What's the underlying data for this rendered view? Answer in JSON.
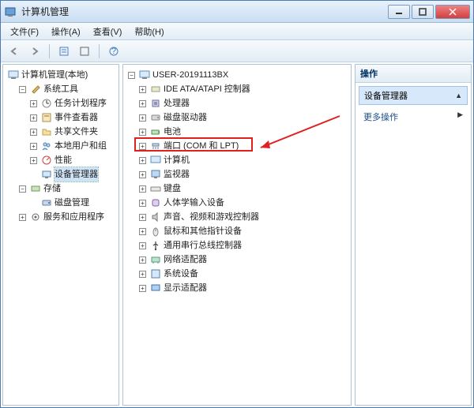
{
  "window_title": "计算机管理",
  "menu": {
    "file": "文件(F)",
    "action": "操作(A)",
    "view": "查看(V)",
    "help": "帮助(H)"
  },
  "left_tree": {
    "root": "计算机管理(本地)",
    "systools": {
      "label": "系统工具",
      "children": {
        "task": "任务计划程序",
        "event": "事件查看器",
        "shared": "共享文件夹",
        "users": "本地用户和组",
        "perf": "性能",
        "devmgr": "设备管理器"
      }
    },
    "storage": {
      "label": "存储",
      "disk": "磁盘管理"
    },
    "services": "服务和应用程序"
  },
  "mid_tree": {
    "root": "USER-20191113BX",
    "items": {
      "ide": "IDE ATA/ATAPI 控制器",
      "cpu": "处理器",
      "dvd": "磁盘驱动器",
      "battery": "电池",
      "ports": "端口 (COM 和 LPT)",
      "computer": "计算机",
      "monitor": "监视器",
      "keyboard": "键盘",
      "hid": "人体学输入设备",
      "sound": "声音、视频和游戏控制器",
      "mouse": "鼠标和其他指针设备",
      "usb": "通用串行总线控制器",
      "network": "网络适配器",
      "system": "系统设备",
      "display": "显示适配器"
    }
  },
  "right": {
    "head": "操作",
    "selected": "设备管理器",
    "more": "更多操作"
  }
}
